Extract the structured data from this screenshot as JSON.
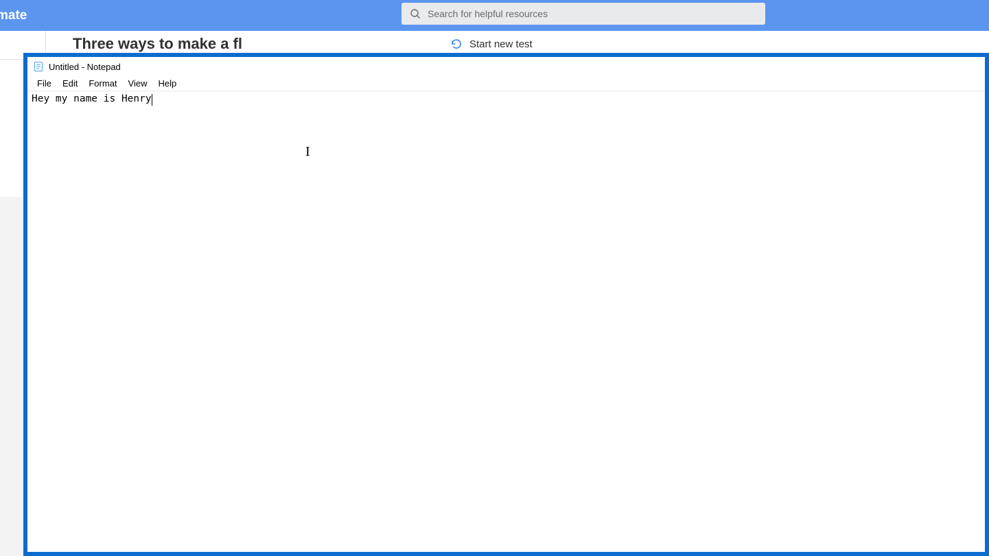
{
  "background": {
    "app_name_fragment": "mate",
    "search_placeholder": "Search for helpful resources",
    "heading_fragment": "Three ways to make a fl",
    "start_new_test": "Start new test"
  },
  "notepad": {
    "title": "Untitled - Notepad",
    "menu": {
      "file": "File",
      "edit": "Edit",
      "format": "Format",
      "view": "View",
      "help": "Help"
    },
    "content": "Hey my name is Henry"
  },
  "icons": {
    "search": "search-icon",
    "refresh": "refresh-icon",
    "notepad": "notepad-icon"
  }
}
